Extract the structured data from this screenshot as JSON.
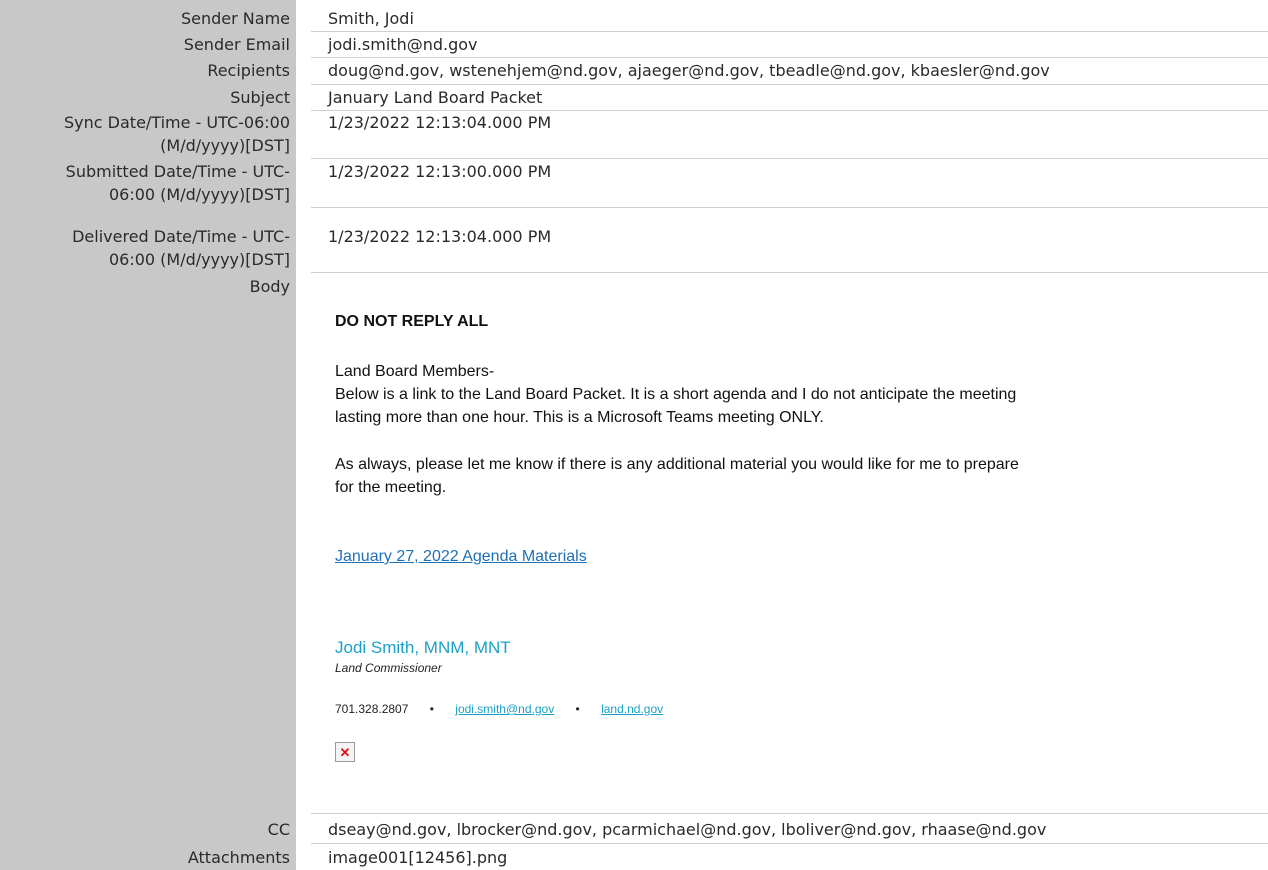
{
  "fields": {
    "sender_name": {
      "label": "Sender Name",
      "value": "Smith, Jodi"
    },
    "sender_email": {
      "label": "Sender Email",
      "value": "jodi.smith@nd.gov"
    },
    "recipients": {
      "label": "Recipients",
      "value": "doug@nd.gov, wstenehjem@nd.gov, ajaeger@nd.gov, tbeadle@nd.gov, kbaesler@nd.gov"
    },
    "subject": {
      "label": "Subject",
      "value": "January Land Board Packet"
    },
    "sync": {
      "label_line1": "Sync Date/Time - UTC-06:00",
      "label_line2": "(M/d/yyyy)[DST]",
      "value": "1/23/2022 12:13:04.000 PM"
    },
    "submitted": {
      "label_line1": "Submitted Date/Time - UTC-",
      "label_line2": "06:00 (M/d/yyyy)[DST]",
      "value": "1/23/2022 12:13:00.000 PM"
    },
    "delivered": {
      "label_line1": "Delivered Date/Time - UTC-",
      "label_line2": "06:00 (M/d/yyyy)[DST]",
      "value": "1/23/2022 12:13:04.000 PM"
    },
    "body_label": "Body",
    "cc": {
      "label": "CC",
      "value": "dseay@nd.gov, lbrocker@nd.gov, pcarmichael@nd.gov, lboliver@nd.gov, rhaase@nd.gov"
    },
    "attachments": {
      "label": "Attachments",
      "value": "image001[12456].png"
    }
  },
  "body": {
    "heading": "DO NOT REPLY ALL",
    "greeting": "Land Board Members-",
    "para1_line1": "Below is a link to the Land Board Packet. It is a short agenda and I do not anticipate the meeting",
    "para1_line2": "lasting more than one hour. This is a Microsoft Teams meeting ONLY.",
    "para2_line1": "As always, please let me know if there is any additional material you would like for me to prepare",
    "para2_line2": "for the meeting.",
    "link": "January 27, 2022 Agenda Materials",
    "signature": {
      "name": "Jodi Smith, MNM, MNT",
      "title": "Land Commissioner",
      "phone": "701.328.2807",
      "separator": "•",
      "email": "jodi.smith@nd.gov",
      "website": "land.nd.gov"
    }
  },
  "colors": {
    "label_bg": "#c8c8c8",
    "link": "#1f6fb5",
    "signature": "#1ba1c6"
  },
  "icons": {
    "broken_image": "broken-image-icon"
  }
}
